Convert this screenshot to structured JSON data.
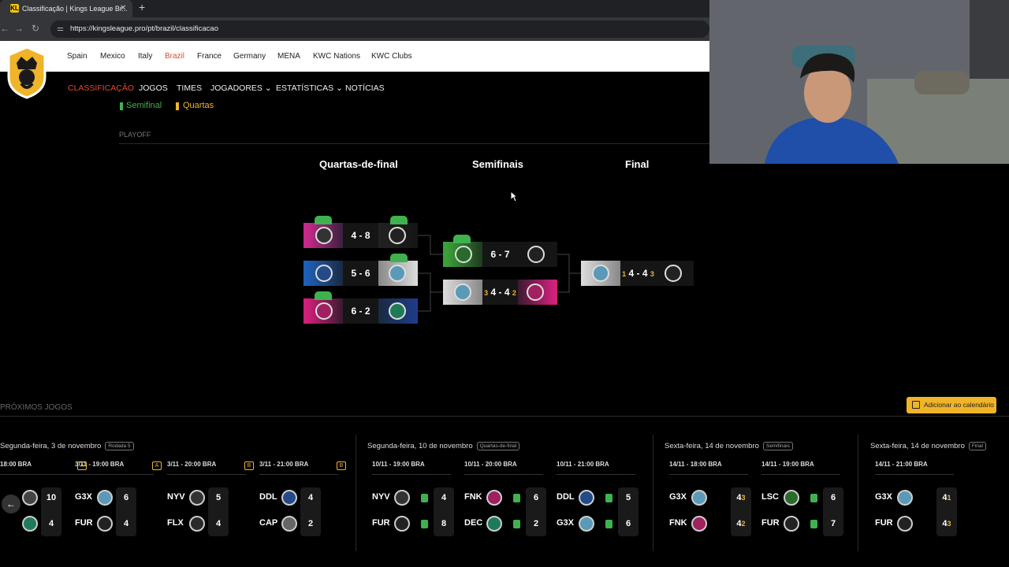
{
  "browser": {
    "tab_title": "Classificação | Kings League Br...",
    "favicon": "KL",
    "url": "https://kingsleague.pro/pt/brazil/classificacao"
  },
  "leagues": [
    "Spain",
    "Mexico",
    "Italy",
    "Brazil",
    "France",
    "Germany",
    "MENA",
    "KWC Nations",
    "KWC Clubs"
  ],
  "active_league": "Brazil",
  "main_nav": [
    "CLASSIFICAÇÃO",
    "JOGOS",
    "TIMES",
    "JOGADORES ⌄",
    "ESTATÍSTICAS ⌄",
    "NOTÍCIAS"
  ],
  "legend": {
    "semifinal": "Semifinal",
    "quartas": "Quartas"
  },
  "playoff_label": "PLAYOFF",
  "columns": {
    "qf": "Quartas-de-final",
    "sf": "Semifinais",
    "final": "Final"
  },
  "bracket": {
    "qf1": {
      "score": "4 - 8"
    },
    "qf2": {
      "score": "5 - 6"
    },
    "qf3": {
      "score": "6 - 2"
    },
    "sf1": {
      "score": "6 - 7"
    },
    "sf2": {
      "pen_left": "3",
      "score": "4 - 4",
      "pen_right": "2"
    },
    "final": {
      "pen_left": "1",
      "score": "4 - 4",
      "pen_right": "3"
    }
  },
  "upcoming": {
    "title": "PRÓXIMOS JOGOS",
    "calendar_button": "Adicionar ao calendário",
    "days": [
      {
        "label": "Segunda-feira, 3 de novembro",
        "stage": "Rodada 5"
      },
      {
        "label": "Segunda-feira, 10 de novembro",
        "stage": "Quartas-de-final"
      },
      {
        "label": "Sexta-feira, 14 de novembro",
        "stage": "Semifinais"
      },
      {
        "label": "Sexta-feira, 14 de novembro",
        "stage": "Final"
      }
    ],
    "games": [
      {
        "time": "18:00 BRA",
        "group": "A",
        "home": "",
        "away": "",
        "home_score": "10",
        "away_score": "4"
      },
      {
        "time": "3/11 - 19:00 BRA",
        "group": "A",
        "home": "G3X",
        "away": "FUR",
        "home_score": "6",
        "away_score": "4"
      },
      {
        "time": "3/11 - 20:00 BRA",
        "group": "B",
        "home": "NYV",
        "away": "FLX",
        "home_score": "5",
        "away_score": "4"
      },
      {
        "time": "3/11 - 21:00 BRA",
        "group": "B",
        "home": "DDL",
        "away": "CAP",
        "home_score": "4",
        "away_score": "2"
      },
      {
        "time": "10/11 - 19:00 BRA",
        "group": "",
        "home": "NYV",
        "away": "FUR",
        "home_score": "4",
        "away_score": "8"
      },
      {
        "time": "10/11 - 20:00 BRA",
        "group": "",
        "home": "FNK",
        "away": "DEC",
        "home_score": "6",
        "away_score": "2"
      },
      {
        "time": "10/11 - 21:00 BRA",
        "group": "",
        "home": "DDL",
        "away": "G3X",
        "home_score": "5",
        "away_score": "6"
      },
      {
        "time": "14/11 - 18:00 BRA",
        "group": "",
        "home": "G3X",
        "away": "FNK",
        "home_score": "4",
        "home_pen": "3",
        "away_score": "4",
        "away_pen": "2"
      },
      {
        "time": "14/11 - 19:00 BRA",
        "group": "",
        "home": "LSC",
        "away": "FUR",
        "home_score": "6",
        "away_score": "7"
      },
      {
        "time": "14/11 - 21:00 BRA",
        "group": "",
        "home": "G3X",
        "away": "FUR",
        "home_score": "4",
        "home_pen": "1",
        "away_score": "4",
        "away_pen": "3"
      }
    ]
  },
  "colors": {
    "accent": "#e04b2d",
    "gold": "#f0b429",
    "green": "#3fb24f"
  }
}
